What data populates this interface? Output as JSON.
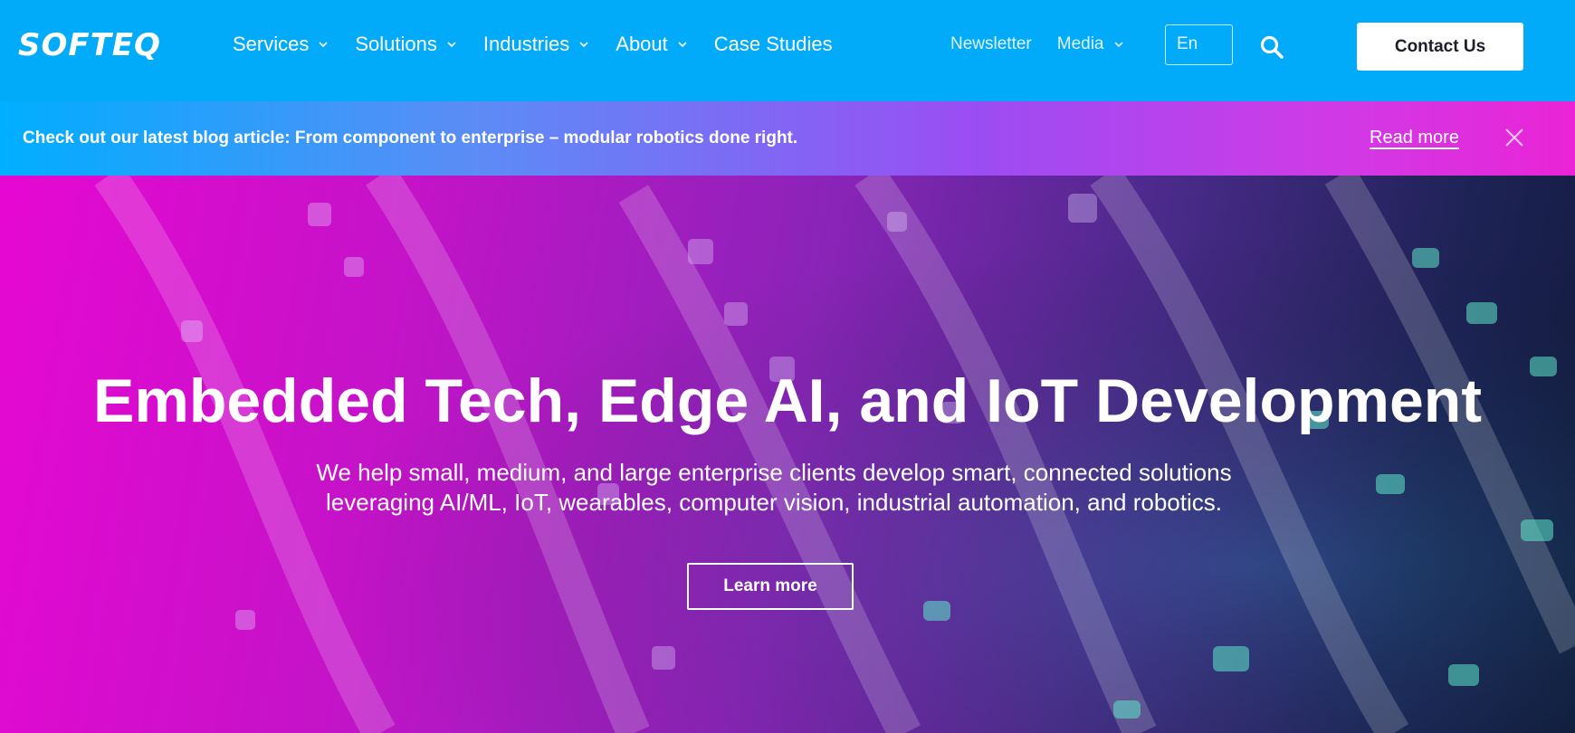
{
  "header": {
    "logo": "SOFTEQ",
    "nav": [
      {
        "label": "Services",
        "has_dropdown": true
      },
      {
        "label": "Solutions",
        "has_dropdown": true
      },
      {
        "label": "Industries",
        "has_dropdown": true
      },
      {
        "label": "About",
        "has_dropdown": true
      },
      {
        "label": "Case Studies",
        "has_dropdown": false
      }
    ],
    "newsletter": "Newsletter",
    "media": "Media",
    "language": "En",
    "contact_label": "Contact Us",
    "background_color": "#02abfa"
  },
  "announcement": {
    "text": "Check out our latest blog article: From component to enterprise – modular robotics done right.",
    "read_more": "Read more",
    "close_icon": "close-icon"
  },
  "hero": {
    "title": "Embedded Tech, Edge AI, and IoT Development",
    "subtitle_line1": "We help small, medium, and large enterprise clients develop smart, connected solutions",
    "subtitle_line2": "leveraging AI/ML, IoT, wearables, computer vision, industrial automation, and robotics.",
    "cta_label": "Learn more",
    "gradient_colors": [
      "#e608d2",
      "#8a24b8",
      "#121a3c"
    ]
  }
}
